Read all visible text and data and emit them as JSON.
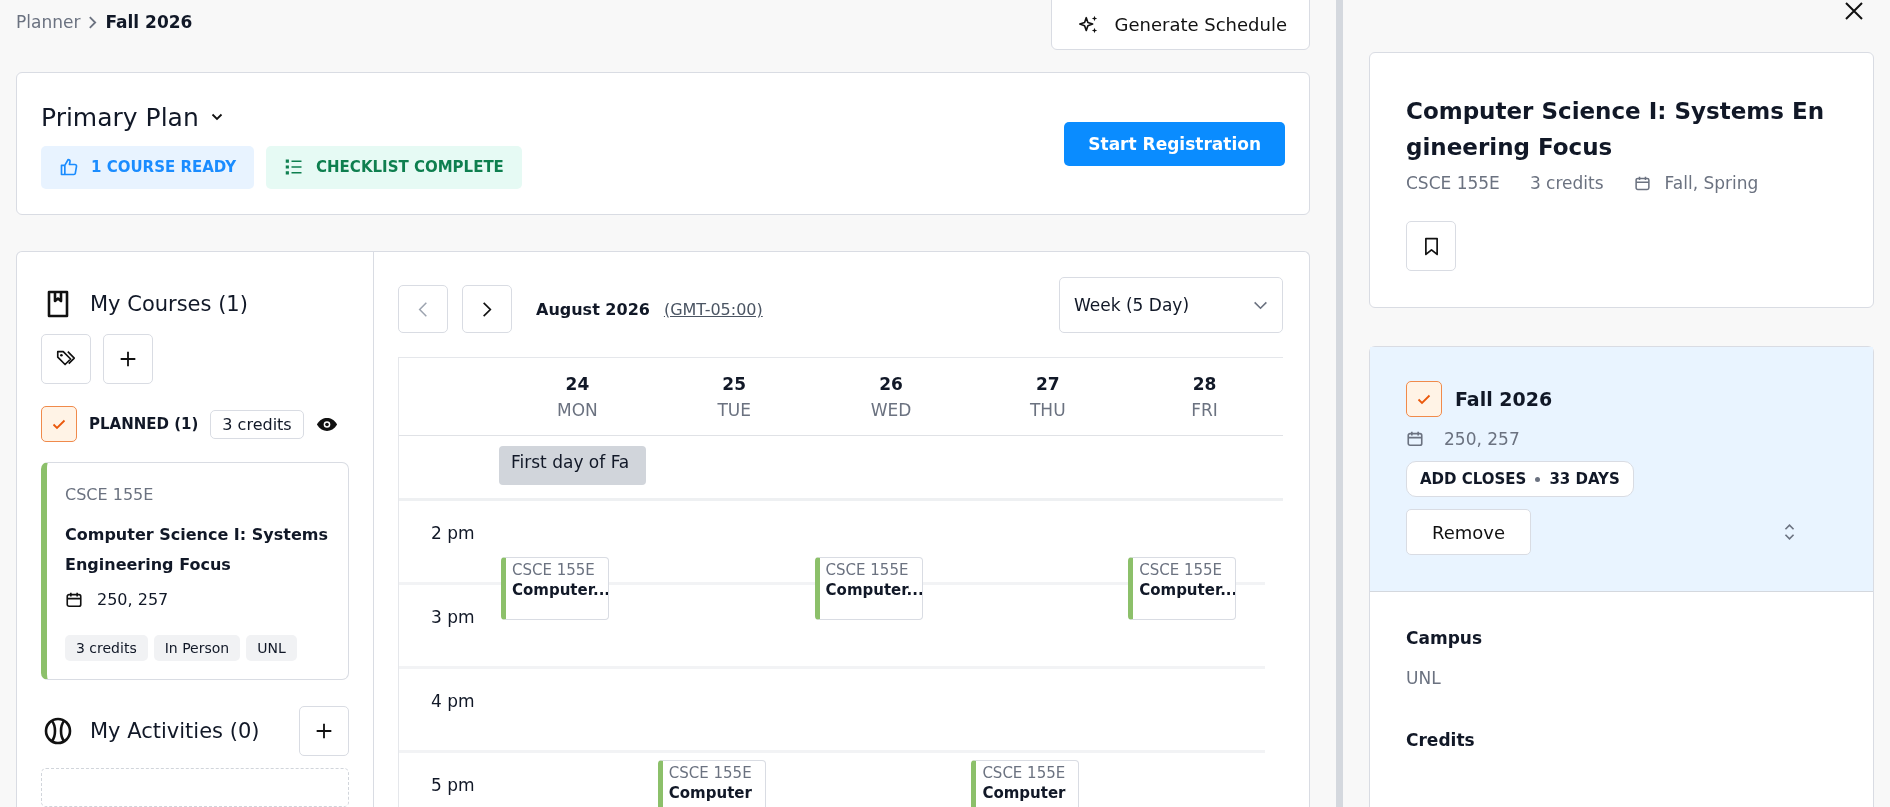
{
  "breadcrumb": {
    "parent": "Planner",
    "current": "Fall 2026"
  },
  "generate_button": "Generate Schedule",
  "plan": {
    "title": "Primary Plan",
    "badges": [
      {
        "kind": "ready",
        "label": "1 COURSE READY"
      },
      {
        "kind": "checklist",
        "label": "CHECKLIST COMPLETE"
      }
    ],
    "primary_button": "Start Registration"
  },
  "my_courses": {
    "title": "My Courses (1)",
    "group": {
      "label": "PLANNED (1)",
      "checked": true,
      "credits": "3 credits"
    },
    "courses": [
      {
        "code": "CSCE 155E",
        "name": "Computer Science I: Systems Engineering Focus",
        "sections": "250, 257",
        "tags": [
          "3 credits",
          "In Person",
          "UNL"
        ],
        "color": "#8cc06a"
      }
    ]
  },
  "my_activities": {
    "title": "My Activities (0)"
  },
  "calendar": {
    "month": "August 2026",
    "timezone": "(GMT-05:00)",
    "view": "Week (5 Day)",
    "days": [
      {
        "date": "24",
        "weekday": "MON",
        "all_day": [
          "First day of Fa"
        ],
        "events": [
          {
            "kind": "afternoon",
            "code": "CSCE 155E",
            "title": "Computer...",
            "color": "#8cc06a"
          }
        ]
      },
      {
        "date": "25",
        "weekday": "TUE",
        "events": [
          {
            "kind": "evening",
            "code": "CSCE 155E",
            "title": "Computer",
            "color": "#8cc06a"
          }
        ]
      },
      {
        "date": "26",
        "weekday": "WED",
        "events": [
          {
            "kind": "afternoon",
            "code": "CSCE 155E",
            "title": "Computer...",
            "color": "#8cc06a"
          }
        ]
      },
      {
        "date": "27",
        "weekday": "THU",
        "events": [
          {
            "kind": "evening",
            "code": "CSCE 155E",
            "title": "Computer",
            "color": "#8cc06a"
          }
        ]
      },
      {
        "date": "28",
        "weekday": "FRI",
        "events": [
          {
            "kind": "afternoon",
            "code": "CSCE 155E",
            "title": "Computer...",
            "color": "#8cc06a"
          }
        ]
      }
    ],
    "hours": [
      {
        "label": "2 pm"
      },
      {
        "label": "3 pm"
      },
      {
        "label": "4 pm"
      },
      {
        "label": "5 pm"
      }
    ]
  },
  "detail": {
    "title": "Computer Science I: Systems Engineering Focus",
    "code": "CSCE 155E",
    "credits": "3 credits",
    "terms": "Fall, Spring",
    "term": {
      "name": "Fall 2026",
      "checked": true,
      "sections": "250, 257",
      "deadline": "ADD CLOSES",
      "deadline_value": "33 DAYS",
      "remove_button": "Remove"
    },
    "fields": [
      {
        "label": "Campus",
        "value": "UNL"
      },
      {
        "label": "Credits"
      }
    ]
  }
}
